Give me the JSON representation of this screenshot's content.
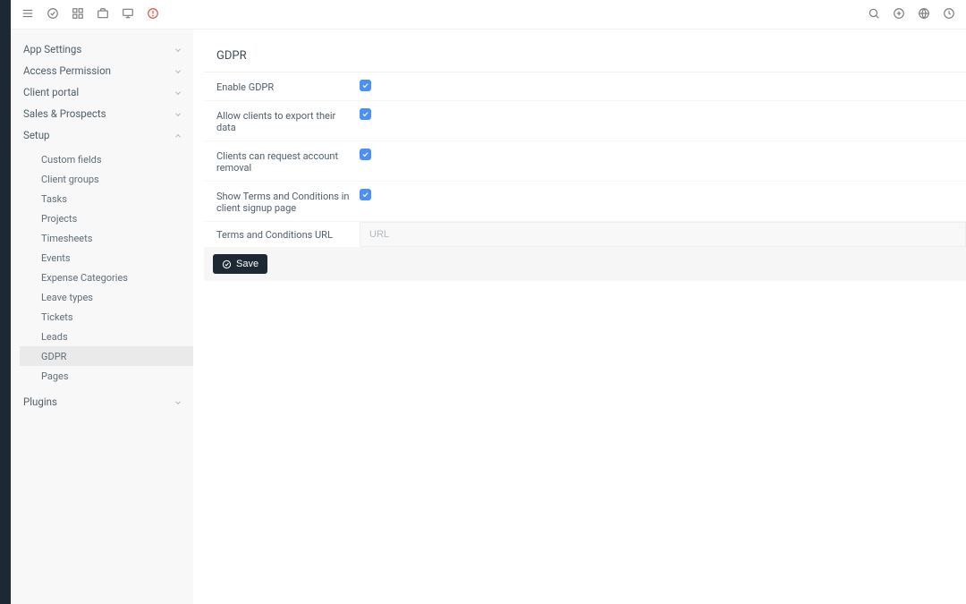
{
  "sidebar": {
    "items": [
      {
        "label": "App Settings",
        "expanded": false
      },
      {
        "label": "Access Permission",
        "expanded": false
      },
      {
        "label": "Client portal",
        "expanded": false
      },
      {
        "label": "Sales & Prospects",
        "expanded": false
      },
      {
        "label": "Setup",
        "expanded": true
      },
      {
        "label": "Plugins",
        "expanded": false
      }
    ],
    "setup_sub": [
      "Custom fields",
      "Client groups",
      "Tasks",
      "Projects",
      "Timesheets",
      "Events",
      "Expense Categories",
      "Leave types",
      "Tickets",
      "Leads",
      "GDPR",
      "Pages"
    ],
    "active_sub": "GDPR"
  },
  "page": {
    "title": "GDPR",
    "rows": {
      "enable_gdpr": {
        "label": "Enable GDPR",
        "checked": true
      },
      "export_data": {
        "label": "Allow clients to export their data",
        "checked": true
      },
      "account_removal": {
        "label": "Clients can request account removal",
        "checked": true
      },
      "terms_signup": {
        "label": "Show Terms and Conditions in client signup page",
        "checked": true
      },
      "terms_url": {
        "label": "Terms and Conditions URL",
        "placeholder": "URL",
        "value": ""
      }
    },
    "save_label": "Save"
  }
}
